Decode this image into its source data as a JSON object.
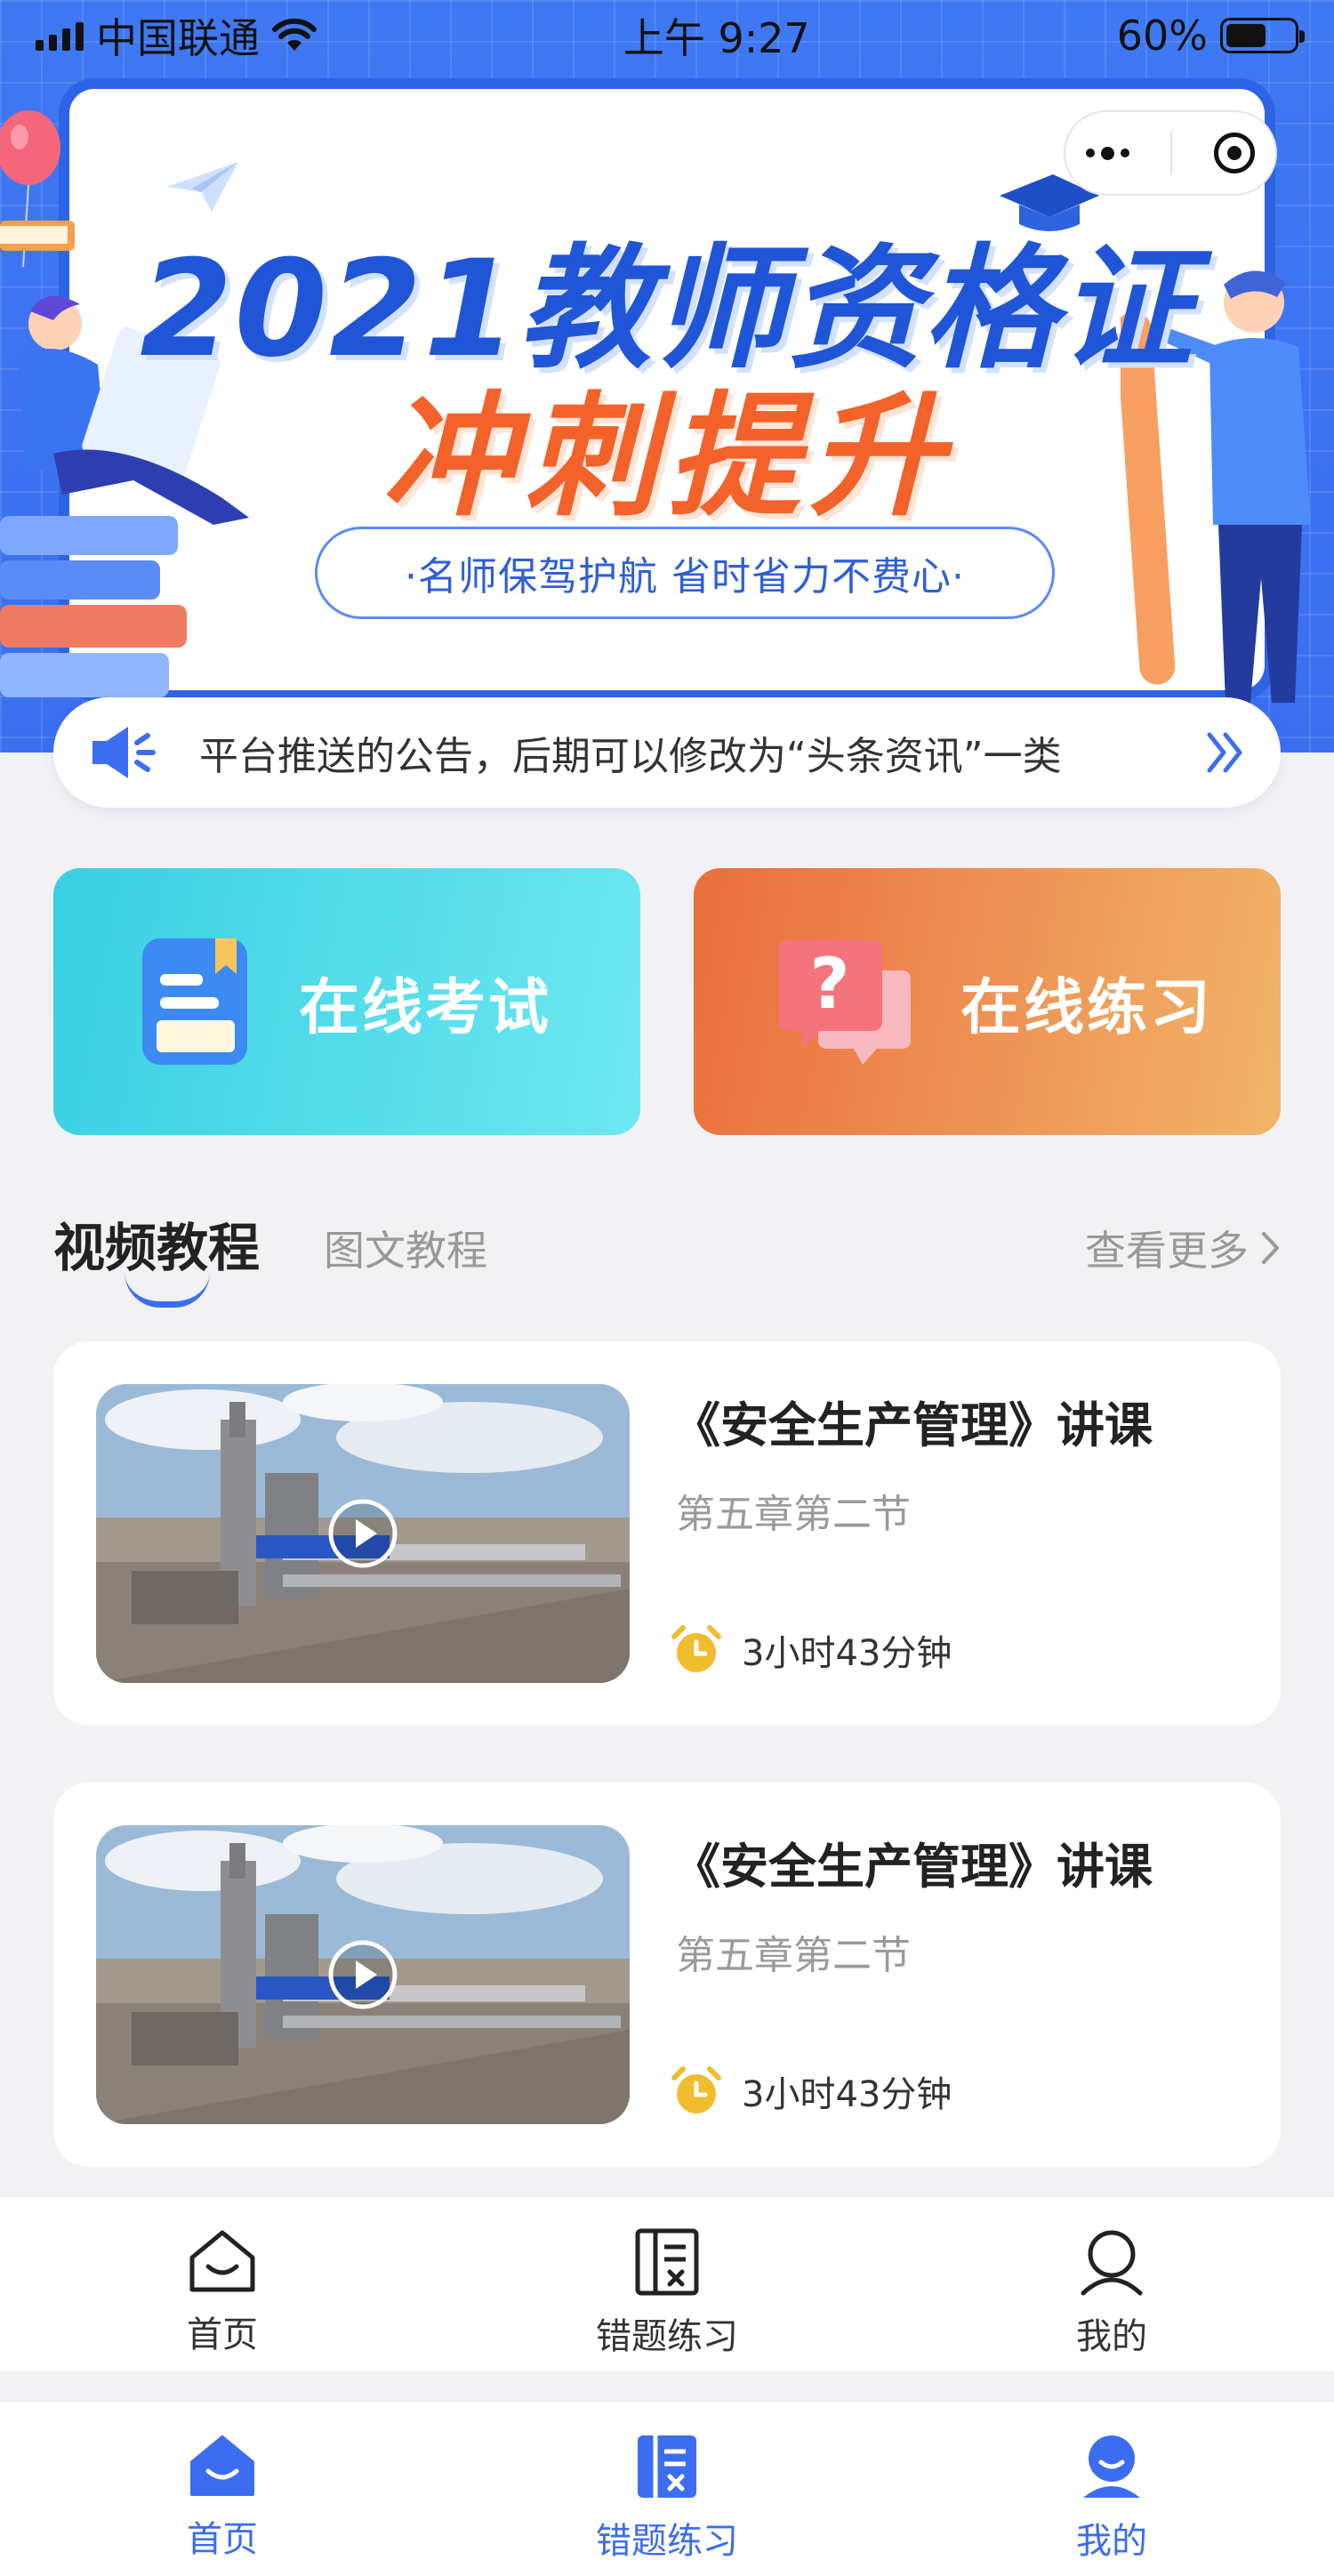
{
  "status_bar": {
    "carrier": "中国联通",
    "time": "上午 9:27",
    "battery_pct": "60%",
    "battery_level": 0.6
  },
  "capsule": {
    "menu_icon": "more-dots-icon",
    "close_icon": "target-close-icon"
  },
  "banner": {
    "title": "2021教师资格证",
    "subtitle": "冲刺提升",
    "tagline": "·名师保驾护航 省时省力不费心·"
  },
  "notice": {
    "icon": "speaker-icon",
    "text": "平台推送的公告，后期可以修改为“头条资讯”一类",
    "arrow_icon": "double-chevron-right-icon"
  },
  "actions": {
    "exam_label": "在线考试",
    "practice_label": "在线练习"
  },
  "tabs": {
    "active_label": "视频教程",
    "inactive_label": "图文教程",
    "more_label": "查看更多"
  },
  "videos": [
    {
      "title": "《安全生产管理》讲课",
      "subtitle": "第五章第二节",
      "duration": "3小时43分钟"
    },
    {
      "title": "《安全生产管理》讲课",
      "subtitle": "第五章第二节",
      "duration": "3小时43分钟"
    }
  ],
  "tabbar": {
    "items": [
      {
        "label": "首页",
        "icon": "home-icon"
      },
      {
        "label": "错题练习",
        "icon": "wrong-questions-icon"
      },
      {
        "label": "我的",
        "icon": "user-icon"
      }
    ]
  },
  "tabbar_active": {
    "items": [
      {
        "label": "首页",
        "icon": "home-icon"
      },
      {
        "label": "错题练习",
        "icon": "wrong-questions-icon"
      },
      {
        "label": "我的",
        "icon": "user-icon"
      }
    ]
  },
  "colors": {
    "accent": "#3c6df0",
    "exam_gradient": [
      "#39d0e3",
      "#6ee8f1"
    ],
    "practice_gradient": [
      "#ea6e3d",
      "#f2b56a"
    ],
    "title_blue": "#1f55d6",
    "title_orange": "#f2622a",
    "clock_yellow": "#f0bd2e"
  }
}
